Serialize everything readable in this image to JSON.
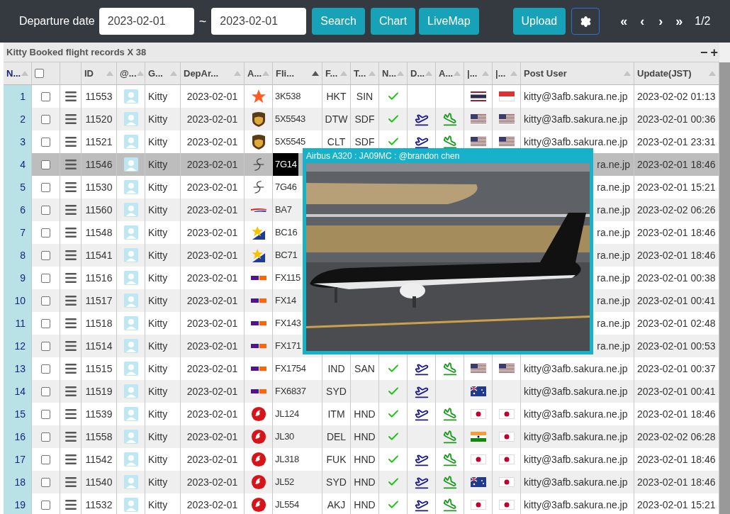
{
  "toolbar": {
    "date_label": "Departure date",
    "date_from": "2023-02-01",
    "separator": "~",
    "date_to": "2023-02-01",
    "buttons": [
      "Search",
      "Chart",
      "LiveMap",
      "Upload"
    ],
    "pager": [
      "«",
      "‹",
      "›",
      "»"
    ],
    "page": "1/2"
  },
  "panel": {
    "title": "Kitty Booked flight records X 38",
    "collapse": "−",
    "expand": "+"
  },
  "columns": [
    {
      "label": "N...",
      "sorted": false
    },
    {
      "kind": "checkbox",
      "checked": false
    },
    {
      "kind": "blank"
    },
    {
      "label": "ID",
      "sorted": false
    },
    {
      "label": "@...",
      "sorted": false
    },
    {
      "label": "G...",
      "sorted": false
    },
    {
      "label": "DepAr...",
      "sorted": false
    },
    {
      "label": "A...",
      "sorted": false
    },
    {
      "label": "Fli...",
      "sorted": true
    },
    {
      "label": "F...",
      "sorted": false
    },
    {
      "label": "T...",
      "sorted": false
    },
    {
      "label": "N...",
      "sorted": false
    },
    {
      "label": "D...",
      "sorted": false
    },
    {
      "label": "A...",
      "sorted": false
    },
    {
      "label": "|...",
      "sorted": false
    },
    {
      "label": "|...",
      "sorted": false
    },
    {
      "label": "Post User",
      "sorted": false
    },
    {
      "label": "Update(JST)",
      "sorted": false
    }
  ],
  "rows": [
    {
      "num": "1",
      "checked": false,
      "selected": false,
      "id": "11553",
      "group": "Kitty",
      "date": "2023-02-01",
      "logo": {
        "kind": "star"
      },
      "flight": "3K538",
      "from": "HKT",
      "to": "SIN",
      "confirmed": true,
      "departure": false,
      "arrival": false,
      "flag_from": {
        "kind": "th"
      },
      "flag_to": {
        "kind": "sg"
      },
      "user": "kitty@3afb.sakura.ne.jp",
      "updated": "2023-02-02 01:13"
    },
    {
      "num": "2",
      "checked": false,
      "selected": false,
      "id": "11520",
      "group": "Kitty",
      "date": "2023-02-01",
      "logo": {
        "kind": "shield"
      },
      "flight": "5X5543",
      "from": "DTW",
      "to": "SDF",
      "confirmed": true,
      "departure": true,
      "arrival": true,
      "flag_from": {
        "kind": "us"
      },
      "flag_to": {
        "kind": "us"
      },
      "user": "kitty@3afb.sakura.ne.jp",
      "updated": "2023-02-01 00:36"
    },
    {
      "num": "3",
      "checked": false,
      "selected": false,
      "id": "11521",
      "group": "Kitty",
      "date": "2023-02-01",
      "logo": {
        "kind": "shield"
      },
      "flight": "5X5545",
      "from": "CLT",
      "to": "SDF",
      "confirmed": true,
      "departure": true,
      "arrival": true,
      "flag_from": {
        "kind": "us"
      },
      "flag_to": {
        "kind": "us"
      },
      "user": "kitty@3afb.sakura.ne.jp",
      "updated": "2023-02-01 23:31"
    },
    {
      "num": "4",
      "checked": false,
      "selected": true,
      "id": "11546",
      "group": "Kitty",
      "date": "2023-02-01",
      "logo": {
        "kind": "script"
      },
      "flight": "7G14",
      "user": "ra.ne.jp",
      "updated": "2023-02-01 18:46"
    },
    {
      "num": "5",
      "checked": false,
      "selected": false,
      "id": "11530",
      "group": "Kitty",
      "date": "2023-02-01",
      "logo": {
        "kind": "script"
      },
      "flight": "7G46",
      "user": "ra.ne.jp",
      "updated": "2023-02-01 15:21"
    },
    {
      "num": "6",
      "checked": false,
      "selected": false,
      "id": "11560",
      "group": "Kitty",
      "date": "2023-02-01",
      "logo": {
        "kind": "ribbon"
      },
      "flight": "BA7",
      "user": "ra.ne.jp",
      "updated": "2023-02-02 06:26"
    },
    {
      "num": "7",
      "checked": false,
      "selected": false,
      "id": "11548",
      "group": "Kitty",
      "date": "2023-02-01",
      "logo": {
        "kind": "bluestar"
      },
      "flight": "BC16",
      "user": "ra.ne.jp",
      "updated": "2023-02-01 18:46"
    },
    {
      "num": "8",
      "checked": false,
      "selected": false,
      "id": "11541",
      "group": "Kitty",
      "date": "2023-02-01",
      "logo": {
        "kind": "bluestar"
      },
      "flight": "BC71",
      "user": "ra.ne.jp",
      "updated": "2023-02-01 18:46"
    },
    {
      "num": "9",
      "checked": false,
      "selected": false,
      "id": "11516",
      "group": "Kitty",
      "date": "2023-02-01",
      "logo": {
        "kind": "fedex"
      },
      "flight": "FX115",
      "user": "ra.ne.jp",
      "updated": "2023-02-01 00:38"
    },
    {
      "num": "10",
      "checked": false,
      "selected": false,
      "id": "11517",
      "group": "Kitty",
      "date": "2023-02-01",
      "logo": {
        "kind": "fedex"
      },
      "flight": "FX14",
      "user": "ra.ne.jp",
      "updated": "2023-02-01 00:41"
    },
    {
      "num": "11",
      "checked": false,
      "selected": false,
      "id": "11518",
      "group": "Kitty",
      "date": "2023-02-01",
      "logo": {
        "kind": "fedex"
      },
      "flight": "FX143",
      "user": "ra.ne.jp",
      "updated": "2023-02-01 02:48"
    },
    {
      "num": "12",
      "checked": false,
      "selected": false,
      "id": "11514",
      "group": "Kitty",
      "date": "2023-02-01",
      "logo": {
        "kind": "fedex"
      },
      "flight": "FX171",
      "user": "ra.ne.jp",
      "updated": "2023-02-01 00:53"
    },
    {
      "num": "13",
      "checked": false,
      "selected": false,
      "id": "11515",
      "group": "Kitty",
      "date": "2023-02-01",
      "logo": {
        "kind": "fedex"
      },
      "flight": "FX1754",
      "from": "IND",
      "to": "SAN",
      "confirmed": true,
      "departure": true,
      "arrival": true,
      "flag_from": {
        "kind": "us"
      },
      "flag_to": {
        "kind": "us"
      },
      "user": "kitty@3afb.sakura.ne.jp",
      "updated": "2023-02-01 00:37"
    },
    {
      "num": "14",
      "checked": false,
      "selected": false,
      "id": "11519",
      "group": "Kitty",
      "date": "2023-02-01",
      "logo": {
        "kind": "fedex"
      },
      "flight": "FX6837",
      "from": "SYD",
      "confirmed": true,
      "departure": true,
      "arrival": false,
      "flag_from": {
        "kind": "au"
      },
      "user": "kitty@3afb.sakura.ne.jp",
      "updated": "2023-02-01 00:41"
    },
    {
      "num": "15",
      "checked": false,
      "selected": false,
      "id": "11539",
      "group": "Kitty",
      "date": "2023-02-01",
      "logo": {
        "kind": "crane"
      },
      "flight": "JL124",
      "from": "ITM",
      "to": "HND",
      "confirmed": true,
      "departure": true,
      "arrival": true,
      "flag_from": {
        "kind": "jp"
      },
      "flag_to": {
        "kind": "jp"
      },
      "user": "kitty@3afb.sakura.ne.jp",
      "updated": "2023-02-01 18:46"
    },
    {
      "num": "16",
      "checked": false,
      "selected": false,
      "id": "11558",
      "group": "Kitty",
      "date": "2023-02-01",
      "logo": {
        "kind": "crane"
      },
      "flight": "JL30",
      "from": "DEL",
      "to": "HND",
      "confirmed": true,
      "departure": false,
      "arrival": true,
      "flag_from": {
        "kind": "in"
      },
      "flag_to": {
        "kind": "jp"
      },
      "user": "kitty@3afb.sakura.ne.jp",
      "updated": "2023-02-02 06:28"
    },
    {
      "num": "17",
      "checked": false,
      "selected": false,
      "id": "11542",
      "group": "Kitty",
      "date": "2023-02-01",
      "logo": {
        "kind": "crane"
      },
      "flight": "JL318",
      "from": "FUK",
      "to": "HND",
      "confirmed": true,
      "departure": true,
      "arrival": true,
      "flag_from": {
        "kind": "jp"
      },
      "flag_to": {
        "kind": "jp"
      },
      "user": "kitty@3afb.sakura.ne.jp",
      "updated": "2023-02-01 18:46"
    },
    {
      "num": "18",
      "checked": false,
      "selected": false,
      "id": "11540",
      "group": "Kitty",
      "date": "2023-02-01",
      "logo": {
        "kind": "crane"
      },
      "flight": "JL52",
      "from": "SYD",
      "to": "HND",
      "confirmed": true,
      "departure": true,
      "arrival": true,
      "flag_from": {
        "kind": "au"
      },
      "flag_to": {
        "kind": "jp"
      },
      "user": "kitty@3afb.sakura.ne.jp",
      "updated": "2023-02-01 18:46"
    },
    {
      "num": "19",
      "checked": false,
      "selected": false,
      "id": "11532",
      "group": "Kitty",
      "date": "2023-02-01",
      "logo": {
        "kind": "crane"
      },
      "flight": "JL554",
      "from": "AKJ",
      "to": "HND",
      "confirmed": true,
      "departure": true,
      "arrival": true,
      "flag_from": {
        "kind": "jp"
      },
      "flag_to": {
        "kind": "jp"
      },
      "user": "kitty@3afb.sakura.ne.jp",
      "updated": "2023-02-01 15:21"
    }
  ],
  "popup": {
    "caption": "Airbus A320 : JA09MC : @brandon chen",
    "kind": "picture"
  }
}
